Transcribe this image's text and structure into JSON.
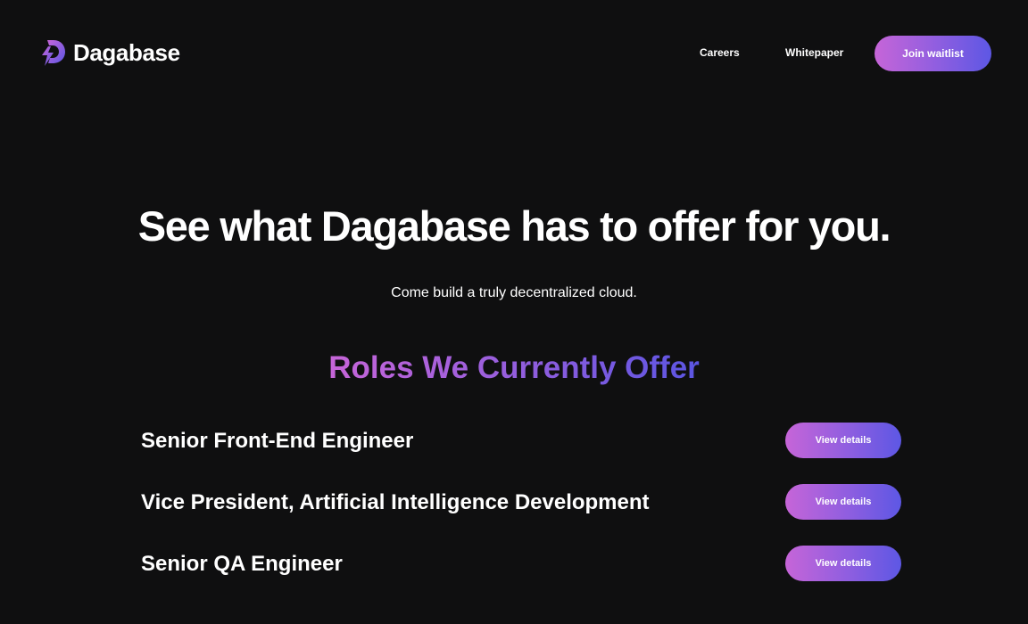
{
  "nav": {
    "brand": "Dagabase",
    "links": [
      {
        "label": "Careers"
      },
      {
        "label": "Whitepaper"
      }
    ],
    "cta_label": "Join waitlist"
  },
  "hero": {
    "title": "See what Dagabase has to offer for you.",
    "subtitle": "Come build a truly decentralized cloud."
  },
  "roles": {
    "heading": "Roles We Currently Offer",
    "items": [
      {
        "title": "Senior Front-End Engineer",
        "button": "View details"
      },
      {
        "title": "Vice President, Artificial Intelligence Development",
        "button": "View details"
      },
      {
        "title": "Senior QA Engineer",
        "button": "View details"
      }
    ]
  },
  "colors": {
    "background": "#0f0f10",
    "gradient_start": "#c665d8",
    "gradient_end": "#5d57e4",
    "text": "#ffffff"
  },
  "icons": {
    "logo": "dagabase-logo-icon"
  }
}
